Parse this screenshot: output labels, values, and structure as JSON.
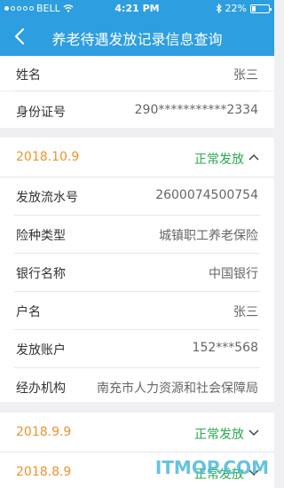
{
  "status_bar": {
    "carrier": "BELL",
    "time": "4:21 PM",
    "battery": "22%",
    "battery_level": 0.22
  },
  "header": {
    "title": "养老待遇发放记录信息查询"
  },
  "person": {
    "name_label": "姓名",
    "name_value": "张三",
    "id_label": "身份证号",
    "id_value": "290***********2334"
  },
  "records": [
    {
      "date": "2018.10.9",
      "status": "正常发放",
      "expanded": true,
      "details": [
        {
          "label": "发放流水号",
          "value": "2600074500754"
        },
        {
          "label": "险种类型",
          "value": "城镇职工养老保险"
        },
        {
          "label": "银行名称",
          "value": "中国银行"
        },
        {
          "label": "户名",
          "value": "张三"
        },
        {
          "label": "发放账户",
          "value": "152***568"
        },
        {
          "label": "经办机构",
          "value": "南充市人力资源和社会保障局"
        }
      ]
    },
    {
      "date": "2018.9.9",
      "status": "正常发放",
      "expanded": false
    },
    {
      "date": "2018.8.9",
      "status": "正常发放",
      "expanded": false
    }
  ],
  "watermark": {
    "text": "ITMOP.COM"
  },
  "colors": {
    "header": "#2d9ee0",
    "date": "#f0932b",
    "status": "#2aaa4f"
  }
}
